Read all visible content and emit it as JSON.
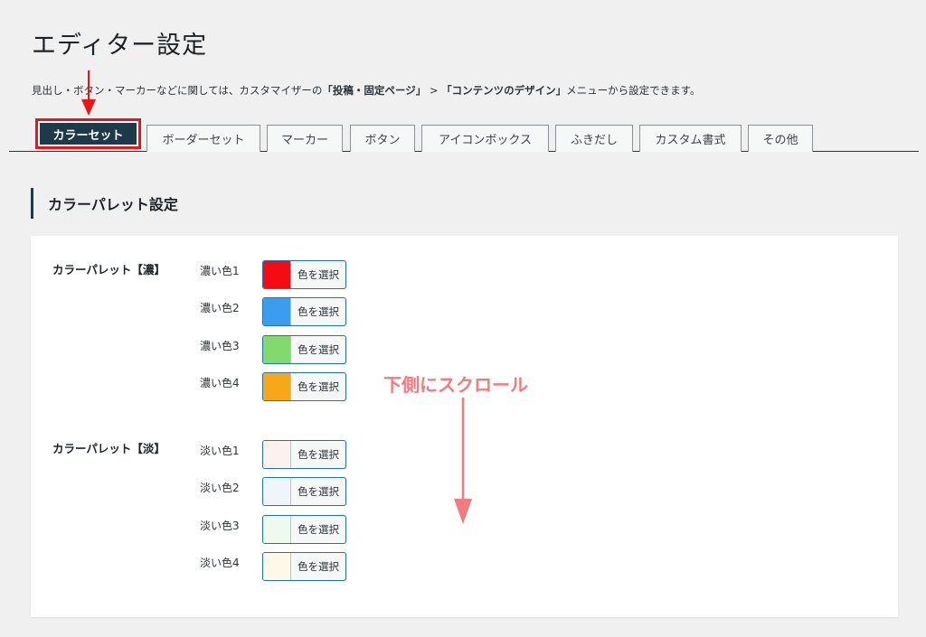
{
  "page": {
    "title": "エディター設定",
    "description": {
      "part1": "見出し・ボタン・マーカーなどに関しては、カスタマイザーの",
      "bold1": "「投稿・固定ページ」",
      "sep": " > ",
      "bold2": "「コンテンツのデザイン」",
      "part2": "メニューから設定できます。"
    }
  },
  "tabs": [
    {
      "label": "カラーセット",
      "active": true
    },
    {
      "label": "ボーダーセット",
      "active": false
    },
    {
      "label": "マーカー",
      "active": false
    },
    {
      "label": "ボタン",
      "active": false
    },
    {
      "label": "アイコンボックス",
      "active": false
    },
    {
      "label": "ふきだし",
      "active": false
    },
    {
      "label": "カスタム書式",
      "active": false
    },
    {
      "label": "その他",
      "active": false
    }
  ],
  "section": {
    "title": "カラーパレット設定",
    "groups": [
      {
        "label": "カラーパレット【濃】",
        "rows": [
          {
            "label": "濃い色1",
            "color": "#f40b13",
            "button": "色を選択"
          },
          {
            "label": "濃い色2",
            "color": "#3c9dee",
            "button": "色を選択"
          },
          {
            "label": "濃い色3",
            "color": "#82d96e",
            "button": "色を選択"
          },
          {
            "label": "濃い色4",
            "color": "#f6a81a",
            "button": "色を選択"
          }
        ]
      },
      {
        "label": "カラーパレット【淡】",
        "rows": [
          {
            "label": "淡い色1",
            "color": "#fdf1ef",
            "button": "色を選択"
          },
          {
            "label": "淡い色2",
            "color": "#eff5fb",
            "button": "色を選択"
          },
          {
            "label": "淡い色3",
            "color": "#effaee",
            "button": "色を選択"
          },
          {
            "label": "淡い色4",
            "color": "#fcf8ea",
            "button": "色を選択"
          }
        ]
      }
    ]
  },
  "annotation": {
    "scroll_hint": "下側にスクロール",
    "color": "#f27b7e",
    "highlight_color": "#e8151a"
  }
}
